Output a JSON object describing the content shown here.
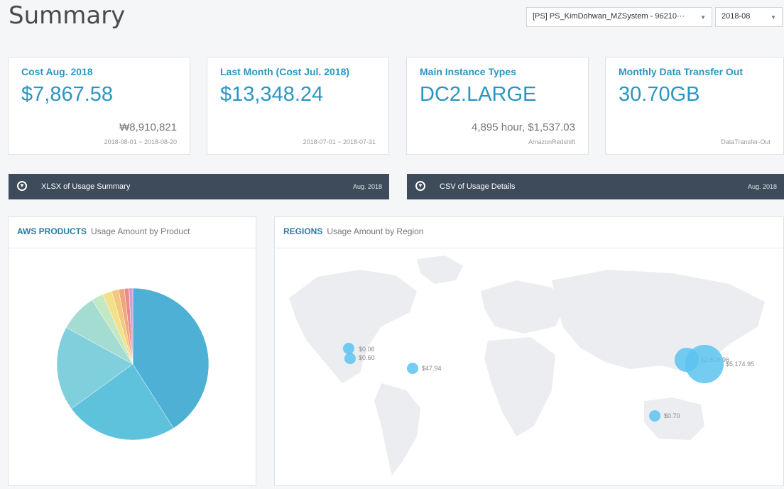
{
  "page": {
    "title": "Summary"
  },
  "filters": {
    "account": "[PS] PS_KimDohwan_MZSystem - 96210···",
    "month": "2018-08"
  },
  "cards": [
    {
      "label": "Cost Aug. 2018",
      "value": "$7,867.58",
      "sub": "₩8,910,821",
      "range": "2018-08-01 ~ 2018-08-20"
    },
    {
      "label": "Last Month (Cost Jul. 2018)",
      "value": "$13,348.24",
      "sub": "",
      "range": "2018-07-01 ~ 2018-07-31"
    },
    {
      "label": "Main Instance Types",
      "value": "DC2.LARGE",
      "sub": "4,895 hour, $1,537.03",
      "range": "AmazonRedshift"
    },
    {
      "label": "Monthly Data Transfer Out",
      "value": "30.70GB",
      "sub": "",
      "range": "DataTransfer-Out"
    }
  ],
  "downloads": [
    {
      "label": "XLSX of Usage Summary",
      "date": "Aug. 2018"
    },
    {
      "label": "CSV of Usage Details",
      "date": "Aug. 2018"
    }
  ],
  "products_panel": {
    "title": "AWS PRODUCTS",
    "subtitle": "Usage Amount by Product"
  },
  "regions_panel": {
    "title": "REGIONS",
    "subtitle": "Usage Amount by Region"
  },
  "chart_data": {
    "type": "pie",
    "title": "AWS PRODUCTS",
    "subtitle": "Usage Amount by Product",
    "values": [
      41.0,
      24.0,
      18.0,
      8.0,
      2.5,
      2.0,
      1.5,
      1.2,
      1.0,
      0.8
    ],
    "colors": [
      "#4fb0d6",
      "#5ec2dd",
      "#7fcfdc",
      "#a5dcd2",
      "#c4e7c4",
      "#f3e18a",
      "#f4c77c",
      "#f0a57c",
      "#ea8a8a",
      "#c9a3d6"
    ]
  },
  "regions": [
    {
      "label": "$0.06",
      "color": "#5cc3ee"
    },
    {
      "label": "$0.60",
      "color": "#5cc3ee"
    },
    {
      "label": "$47.94",
      "color": "#5cc3ee"
    },
    {
      "label": "$2,608.96",
      "color": "#5cc3ee"
    },
    {
      "label": "$5,174.95",
      "color": "#5cc3ee"
    },
    {
      "label": "$0.70",
      "color": "#5cc3ee"
    }
  ]
}
